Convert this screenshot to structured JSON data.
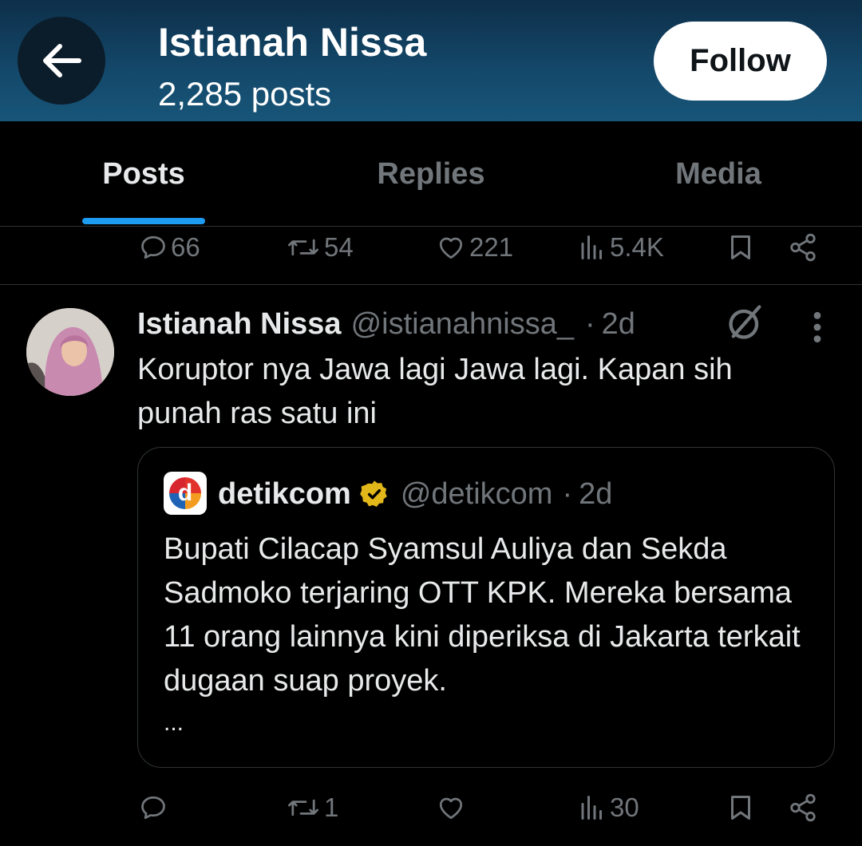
{
  "header": {
    "name": "Istianah Nissa",
    "post_count": "2,285 posts",
    "follow_label": "Follow",
    "back_icon": "arrow-left-icon"
  },
  "tabs": [
    {
      "label": "Posts",
      "active": true
    },
    {
      "label": "Replies",
      "active": false
    },
    {
      "label": "Media",
      "active": false
    }
  ],
  "prev_tweet_actions": {
    "replies": "66",
    "reposts": "54",
    "likes": "221",
    "views": "5.4K"
  },
  "tweet": {
    "author_name": "Istianah Nissa",
    "author_handle": "@istianahnissa_",
    "separator": "·",
    "time": "2d",
    "text": "Koruptor nya Jawa lagi Jawa lagi. Kapan sih punah ras satu ini",
    "quote": {
      "name": "detikcom",
      "logo_letter": "d",
      "handle": "@detikcom",
      "separator": "·",
      "time": "2d",
      "text": "Bupati Cilacap Syamsul Auliya dan Sekda Sadmoko terjaring OTT KPK. Mereka bersama 11 orang lainnya kini diperiksa di Jakarta terkait dugaan suap proyek.",
      "ellipsis": "..."
    },
    "actions": {
      "replies": "",
      "reposts": "1",
      "likes": "",
      "views": "30"
    }
  },
  "colors": {
    "accent": "#1d9bf0",
    "muted": "#71767b",
    "verified_gold": "#e2b719"
  }
}
